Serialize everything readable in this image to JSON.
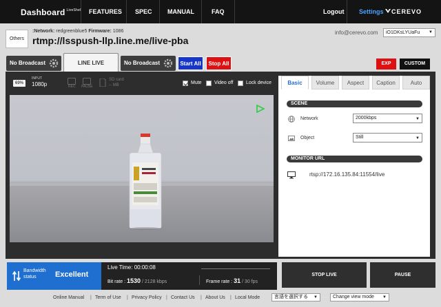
{
  "nav": {
    "logo": "Dashboard",
    "logo_sup": "LiveShell",
    "items": [
      "FEATURES",
      "SPEC",
      "MANUAL",
      "FAQ"
    ],
    "logout": "Logout",
    "settings": "Settings",
    "brand": "CEREVO"
  },
  "header": {
    "others": "Others",
    "network_label": ":Network:",
    "network_value": "redgreenblue5",
    "firmware_label": "Firmware:",
    "firmware_value": "1086",
    "rtmp_url": "rtmp://lsspush-llp.line.me/live-pba",
    "email": "info@cerevo.com",
    "account_select": "iO1DKsLYUaFu"
  },
  "broadcast": {
    "slot1": "No Broadcast",
    "slot2": "LINE LIVE",
    "slot3": "No Broadcast",
    "start_all": "Start All",
    "stop_all": "Stop All",
    "exp": "EXP",
    "custom": "CUSTOM"
  },
  "status": {
    "percent": "69%",
    "input_label": "INPUT",
    "input_res": "1080p",
    "rec_label": "REC",
    "pause_label": "PAUSE",
    "sd_label": "SD card",
    "sd_value": "-- MB",
    "mute": "Mute",
    "video_off": "Video off",
    "lock_device": "Lock device"
  },
  "panel": {
    "tabs": [
      "Basic",
      "Volume",
      "Aspect",
      "Caption",
      "Auto"
    ],
    "scene_header": "SCENE",
    "network_label": "Network",
    "network_value": "2000kbps",
    "object_label": "Object",
    "object_value": "Still",
    "monitor_header": "MONITOR URL",
    "monitor_url": "rtsp://172.16.135.84:11554/live"
  },
  "bottom": {
    "bw_label1": "Bandwidth",
    "bw_label2": "status",
    "bw_value": "Excellent",
    "live_time_label": "Live Time:",
    "live_time": "00:00:08",
    "bitrate_label": "Bit rate :",
    "bitrate_value": "1530",
    "bitrate_max": "/ 2128 kbps",
    "framerate_label": "Frame rate :",
    "framerate_value": "31",
    "framerate_max": "/ 30 fps",
    "stop_live": "STOP LIVE",
    "pause": "PAUSE"
  },
  "footer": {
    "links": [
      "Online Manual",
      "Term of Use",
      "Privacy Policy",
      "Contact Us",
      "About Us",
      "Local Mode"
    ],
    "lang_select": "言語を選択する",
    "view_select": "Change view mode"
  },
  "colors": {
    "accent_blue": "#1f6fd0",
    "start_all_blue": "#1536c8",
    "stop_red": "#dd1111",
    "nav_bg": "#141414",
    "play_green": "#2ecc40"
  }
}
